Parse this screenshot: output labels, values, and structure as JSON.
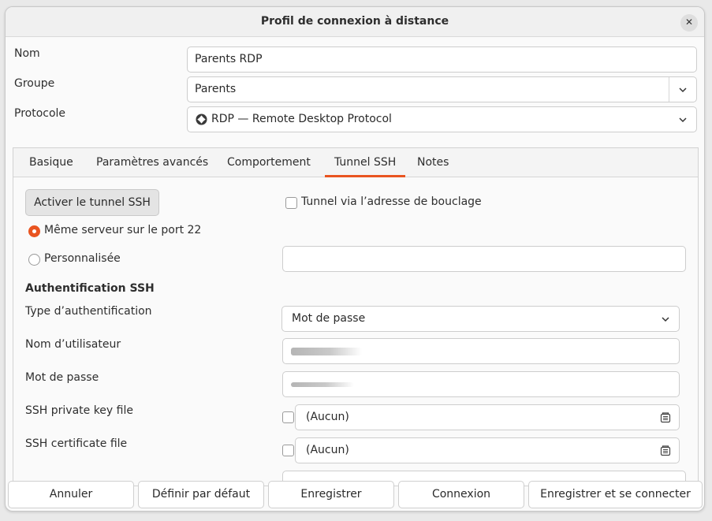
{
  "window": {
    "title": "Profil de connexion à distance",
    "close_glyph": "✕"
  },
  "form": {
    "name_label": "Nom",
    "name_value": "Parents RDP",
    "group_label": "Groupe",
    "group_value": "Parents",
    "protocol_label": "Protocole",
    "protocol_value": "RDP — Remote Desktop Protocol",
    "protocol_icon": "rdp-icon"
  },
  "tabs": [
    {
      "label": "Basique",
      "active": false
    },
    {
      "label": "Paramètres avancés",
      "active": false
    },
    {
      "label": "Comportement",
      "active": false
    },
    {
      "label": "Tunnel SSH",
      "active": true
    },
    {
      "label": "Notes",
      "active": false
    }
  ],
  "ssh_tunnel": {
    "enable_button": "Activer le tunnel SSH",
    "loopback_label": "Tunnel via l’adresse de bouclage",
    "same_server_label": "Même serveur sur le port 22",
    "custom_label": "Personnalisée",
    "custom_value": "",
    "auth_section": "Authentification SSH",
    "auth_type_label": "Type d’authentification",
    "auth_type_value": "Mot de passe",
    "username_label": "Nom d’utilisateur",
    "password_label": "Mot de passe",
    "private_key_label": "SSH private key file",
    "private_key_value": "(Aucun)",
    "certificate_label": "SSH certificate file",
    "certificate_value": "(Aucun)"
  },
  "footer": {
    "cancel": "Annuler",
    "set_default": "Définir par défaut",
    "save": "Enregistrer",
    "connect": "Connexion",
    "save_connect": "Enregistrer et se connecter"
  },
  "colors": {
    "accent": "#e95420"
  }
}
